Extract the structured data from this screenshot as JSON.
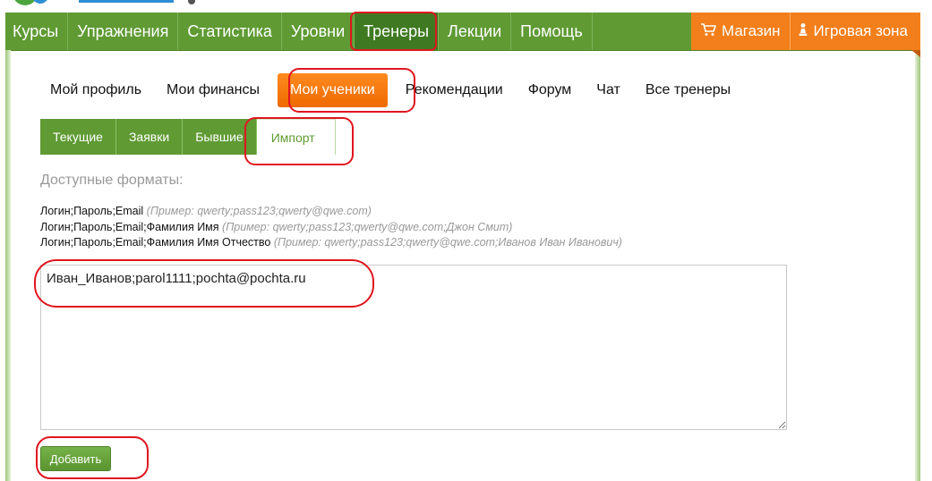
{
  "top_nav": {
    "items": [
      {
        "label": "Курсы"
      },
      {
        "label": "Упражнения"
      },
      {
        "label": "Статистика"
      },
      {
        "label": "Уровни"
      },
      {
        "label": "Тренеры"
      },
      {
        "label": "Лекции"
      },
      {
        "label": "Помощь"
      }
    ],
    "active_item": "Тренеры",
    "shop_label": "Магазин",
    "play_label": "Игровая зона"
  },
  "sub_nav": {
    "items": [
      {
        "label": "Мой профиль"
      },
      {
        "label": "Мои финансы"
      },
      {
        "label": "Мои ученики"
      },
      {
        "label": "Рекомендации"
      },
      {
        "label": "Форум"
      },
      {
        "label": "Чат"
      },
      {
        "label": "Все тренеры"
      }
    ],
    "active_item": "Мои ученики"
  },
  "tabs": {
    "items": [
      {
        "label": "Текущие"
      },
      {
        "label": "Заявки"
      },
      {
        "label": "Бывшие"
      },
      {
        "label": "Импорт"
      }
    ],
    "active_item": "Импорт"
  },
  "formats": {
    "title": "Доступные форматы:",
    "lines": [
      {
        "format": "Логин;Пароль;Email",
        "example": "(Пример: qwerty;pass123;qwerty@qwe.com)"
      },
      {
        "format": "Логин;Пароль;Email;Фамилия Имя",
        "example": "(Пример: qwerty;pass123;qwerty@qwe.com;Джон Смит)"
      },
      {
        "format": "Логин;Пароль;Email;Фамилия Имя Отчество",
        "example": "(Пример: qwerty;pass123;qwerty@qwe.com;Иванов Иван Иванович)"
      }
    ]
  },
  "import_input": {
    "value": "Иван_Иванов;parol1111;pochta@pochta.ru"
  },
  "add_button_label": "Добавить",
  "colors": {
    "nav_green": "#5f9a33",
    "nav_active": "#3f7a22",
    "accent_orange": "#f27f1b",
    "highlight_red": "#e0151f"
  },
  "icons": {
    "shop": "cart-icon",
    "play": "pawn-icon",
    "resize": "resize-grip-icon"
  }
}
